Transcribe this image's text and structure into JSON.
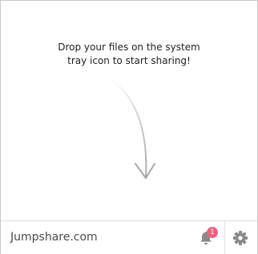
{
  "drop_message": {
    "line1": "Drop your files on the system",
    "line2": "tray icon to start sharing!"
  },
  "footer": {
    "site_link": "Jumpshare.com",
    "notification_count": "1"
  },
  "colors": {
    "badge": "#f3607e",
    "icon": "#8a8a8a",
    "arrow": "#b8b8b8"
  },
  "icons": {
    "bell": "bell-icon",
    "gear": "gear-icon",
    "arrow": "curved-arrow-down-icon"
  }
}
